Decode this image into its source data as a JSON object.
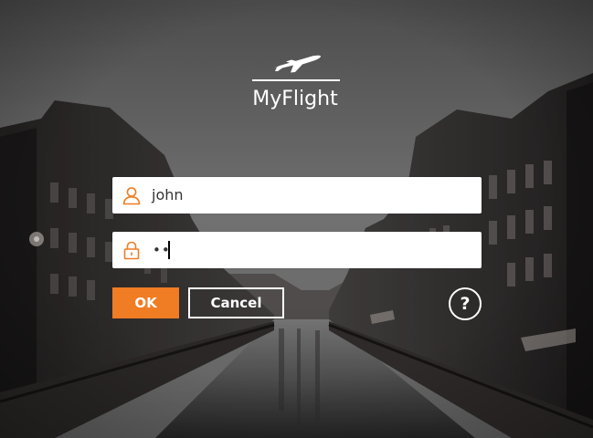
{
  "app": {
    "name": "MyFlight",
    "logo_icon": "airplane-icon"
  },
  "login": {
    "username": {
      "icon": "user-icon",
      "value": "john"
    },
    "password": {
      "icon": "lock-icon",
      "masked_value": "••"
    }
  },
  "actions": {
    "ok_label": "OK",
    "cancel_label": "Cancel",
    "help_label": "?"
  },
  "colors": {
    "accent": "#f07c23",
    "text_on_dark": "#ffffff",
    "field_bg": "#ffffff"
  }
}
